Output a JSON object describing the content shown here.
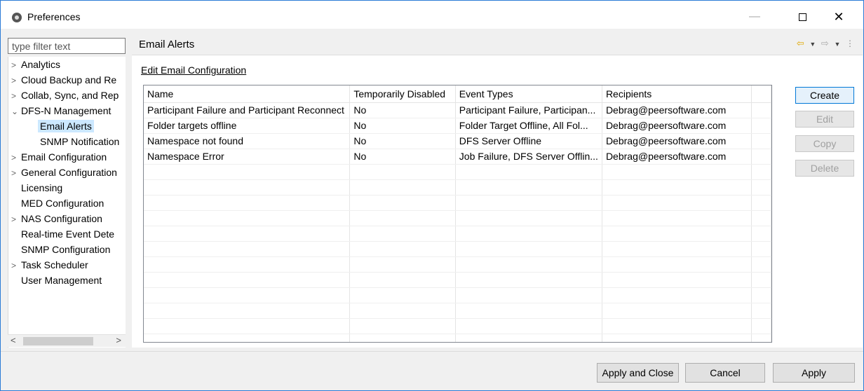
{
  "window": {
    "title": "Preferences",
    "minimize": "—",
    "close": "✕"
  },
  "filter": {
    "placeholder": "type filter text"
  },
  "tree": [
    {
      "label": "Analytics",
      "arrow": ">"
    },
    {
      "label": "Cloud Backup and Re",
      "arrow": ">"
    },
    {
      "label": "Collab, Sync, and Rep",
      "arrow": ">"
    },
    {
      "label": "DFS-N Management",
      "arrow": "⌄"
    },
    {
      "label": "Email Alerts",
      "arrow": ""
    },
    {
      "label": "SNMP Notification",
      "arrow": ""
    },
    {
      "label": "Email Configuration",
      "arrow": ">"
    },
    {
      "label": "General Configuration",
      "arrow": ">"
    },
    {
      "label": "Licensing",
      "arrow": ""
    },
    {
      "label": "MED Configuration",
      "arrow": ""
    },
    {
      "label": "NAS Configuration",
      "arrow": ">"
    },
    {
      "label": "Real-time Event Dete",
      "arrow": ""
    },
    {
      "label": "SNMP Configuration",
      "arrow": ""
    },
    {
      "label": "Task Scheduler",
      "arrow": ">"
    },
    {
      "label": "User Management",
      "arrow": ""
    }
  ],
  "scroll": {
    "left": "<",
    "right": ">"
  },
  "page": {
    "title": "Email Alerts",
    "link": "Edit Email Configuration",
    "nav": {
      "back": "⇦",
      "dd": "▼",
      "fwd": "⇨",
      "menu": "⋮"
    }
  },
  "table": {
    "columns": [
      "Name",
      "Temporarily Disabled",
      "Event Types",
      "Recipients",
      ""
    ],
    "rows": [
      [
        "Participant Failure and Participant Reconnect",
        "No",
        "Participant Failure, Participan...",
        "Debrag@peersoftware.com",
        ""
      ],
      [
        "Folder targets offline",
        "No",
        "Folder Target Offline, All Fol...",
        "Debrag@peersoftware.com",
        ""
      ],
      [
        "Namespace not found",
        "No",
        "DFS Server Offline",
        "Debrag@peersoftware.com",
        ""
      ],
      [
        "Namespace Error",
        "No",
        "Job Failure, DFS Server Offlin...",
        "Debrag@peersoftware.com",
        ""
      ]
    ]
  },
  "buttons": {
    "create": "Create",
    "edit": "Edit",
    "copy": "Copy",
    "delete": "Delete",
    "apply_close": "Apply and Close",
    "cancel": "Cancel",
    "apply": "Apply"
  }
}
